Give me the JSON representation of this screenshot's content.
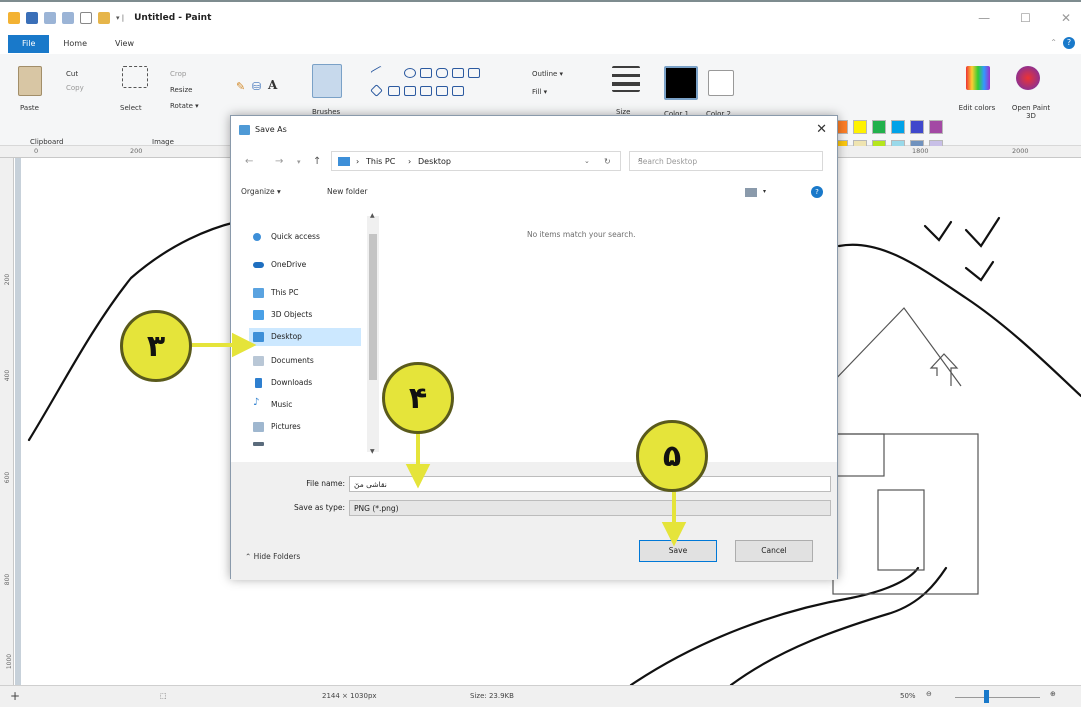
{
  "window": {
    "title": "Untitled - Paint",
    "minimize": "—",
    "maximize": "☐",
    "close": "✕"
  },
  "tabs": [
    "File",
    "Home",
    "View"
  ],
  "ribbon": {
    "clipboard": {
      "label": "Clipboard",
      "paste": "Paste",
      "cut": "Cut",
      "copy": "Copy"
    },
    "image": {
      "label": "Image",
      "select": "Select",
      "crop": "Crop",
      "resize": "Resize",
      "rotate": "Rotate ▾"
    },
    "brushes": "Brushes",
    "outline": "Outline ▾",
    "fill": "Fill ▾",
    "size": "Size",
    "color1": "Color 1",
    "color2": "Color 2",
    "edit_colors": "Edit colors",
    "open_paint3d": "Open Paint 3D",
    "tools_text_icon": "A",
    "palette": [
      "#000000",
      "#7f7f7f",
      "#880015",
      "#ed1c24",
      "#ff7f27",
      "#fff200",
      "#22b14c",
      "#00a2e8",
      "#3f48cc",
      "#a349a4",
      "#ffffff",
      "#c3c3c3",
      "#b97a57",
      "#ffaec9",
      "#ffc90e",
      "#efe4b0",
      "#b5e61d",
      "#99d9ea",
      "#7092be",
      "#c8bfe7"
    ]
  },
  "ruler": [
    "0",
    "200",
    "1800",
    "2000"
  ],
  "vruler": [
    "200",
    "400",
    "600",
    "800",
    "1000"
  ],
  "status": {
    "dimensions": "2144 × 1030px",
    "size": "Size: 23.9KB",
    "zoom": "50%"
  },
  "dialog": {
    "title": "Save As",
    "breadcrumb": [
      "This PC",
      "Desktop"
    ],
    "breadcrumb_sep": "›",
    "search_placeholder": "Search Desktop",
    "organize": "Organize ▾",
    "new_folder": "New folder",
    "empty_message": "No items match your search.",
    "nav_items": [
      "Quick access",
      "OneDrive",
      "This PC",
      "3D Objects",
      "Desktop",
      "Documents",
      "Downloads",
      "Music",
      "Pictures"
    ],
    "file_name_label": "File name:",
    "file_name_value": "نقاشی من",
    "save_type_label": "Save as type:",
    "save_type_value": "PNG (*.png)",
    "hide_folders": "⌃  Hide Folders",
    "save": "Save",
    "cancel": "Cancel"
  },
  "callouts": [
    "۳",
    "۴",
    "۵"
  ]
}
